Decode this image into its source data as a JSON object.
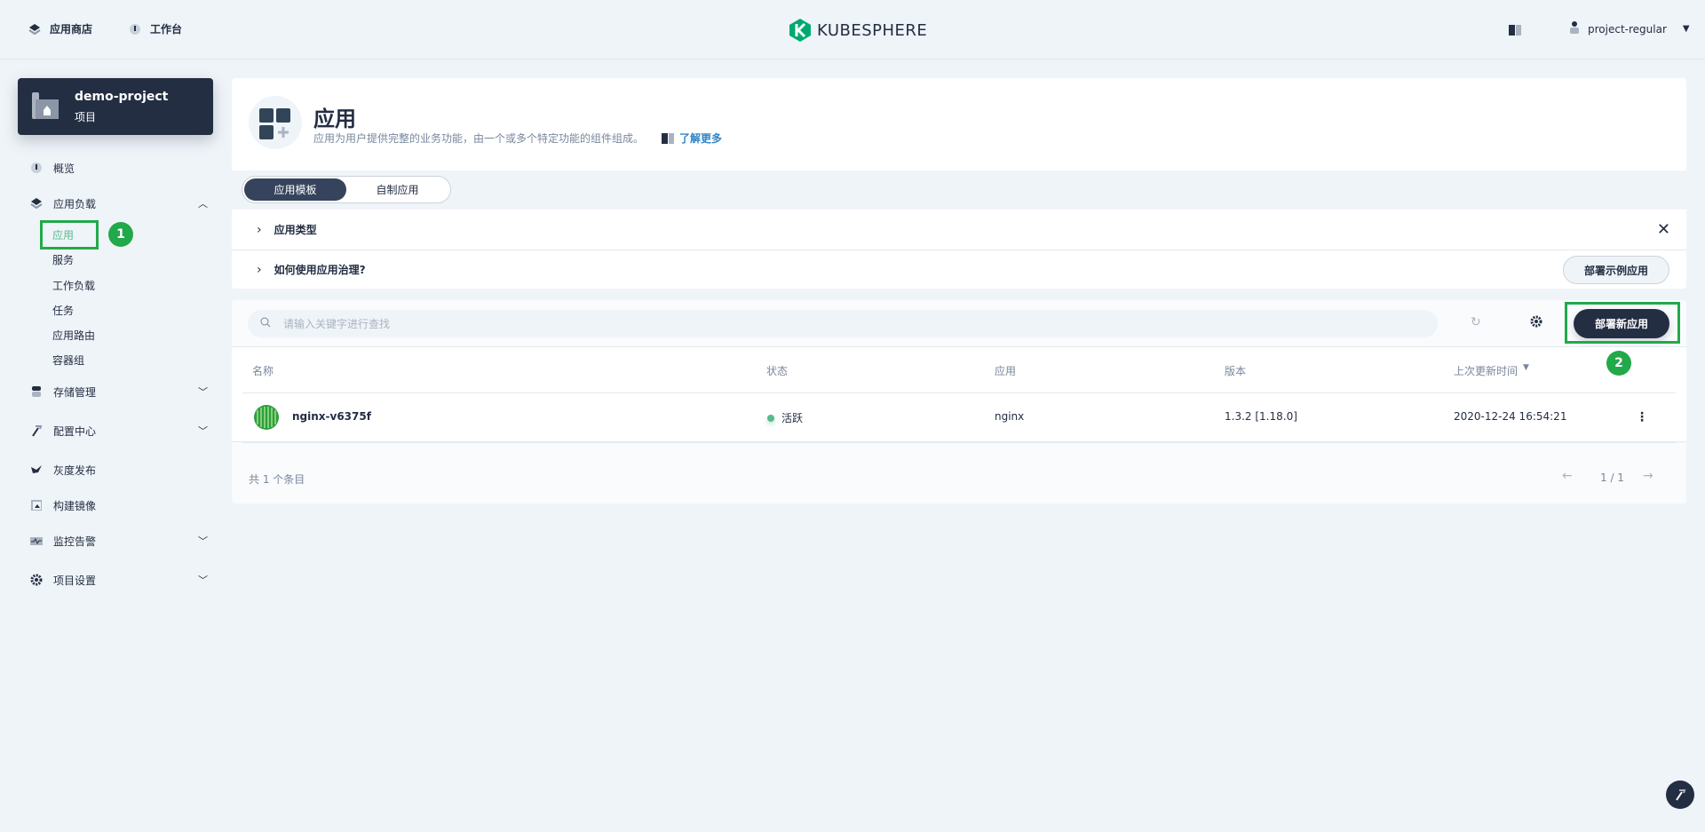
{
  "header": {
    "app_store": "应用商店",
    "workbench": "工作台",
    "brand": "KUBESPHERE",
    "user": "project-regular"
  },
  "project": {
    "name": "demo-project",
    "type": "项目"
  },
  "sidebar": {
    "overview": "概览",
    "workloads": {
      "label": "应用负载",
      "children": [
        "应用",
        "服务",
        "工作负载",
        "任务",
        "应用路由",
        "容器组"
      ]
    },
    "storage": "存储管理",
    "config": "配置中心",
    "grayscale": "灰度发布",
    "image_builder": "构建镜像",
    "monitoring": "监控告警",
    "settings": "项目设置"
  },
  "annotations": {
    "step1": "1",
    "step2": "2",
    "highlight_color": "#22a94a"
  },
  "page": {
    "title": "应用",
    "description": "应用为用户提供完整的业务功能，由一个或多个特定功能的组件组成。",
    "learn_more": "了解更多"
  },
  "tabs": [
    {
      "label": "应用模板",
      "active": true
    },
    {
      "label": "自制应用",
      "active": false
    }
  ],
  "collapsibles": {
    "app_types": "应用类型",
    "how_to": "如何使用应用治理?",
    "deploy_sample": "部署示例应用"
  },
  "toolbar": {
    "search_placeholder": "请输入关键字进行查找",
    "deploy_new": "部署新应用"
  },
  "table": {
    "columns": [
      "名称",
      "状态",
      "应用",
      "版本",
      "上次更新时间"
    ],
    "rows": [
      {
        "name": "nginx-v6375f",
        "status": "活跃",
        "app": "nginx",
        "version": "1.3.2 [1.18.0]",
        "updated": "2020-12-24 16:54:21"
      }
    ],
    "total": "共 1 个条目",
    "page": "1 / 1"
  },
  "colors": {
    "primary": "#242e42",
    "success": "#55bc8a",
    "link": "#3385c7"
  }
}
